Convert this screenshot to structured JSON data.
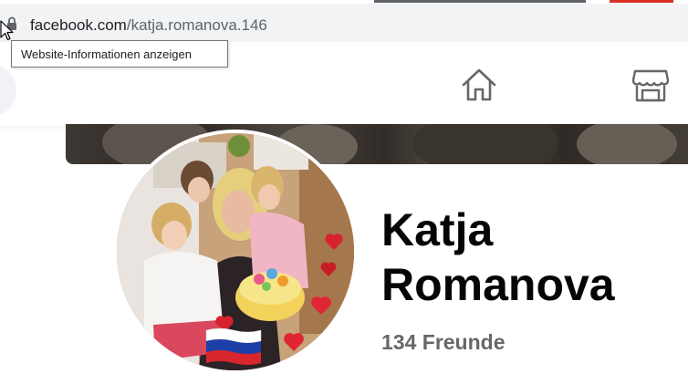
{
  "browser": {
    "url_domain": "facebook.com",
    "url_path": "/katja.romanova.146",
    "tooltip": "Website-Informationen anzeigen",
    "icons": [
      "lock-icon",
      "mouse-cursor-icon"
    ]
  },
  "header": {
    "icons": [
      "home-icon",
      "marketplace-icon"
    ]
  },
  "profile": {
    "name_line1": "Katja",
    "name_line2": "Romanova",
    "friends": "134 Freunde"
  },
  "colors": {
    "friends_text": "#65676b",
    "name_text": "#050505",
    "address_bar": "#f1f3f4"
  }
}
